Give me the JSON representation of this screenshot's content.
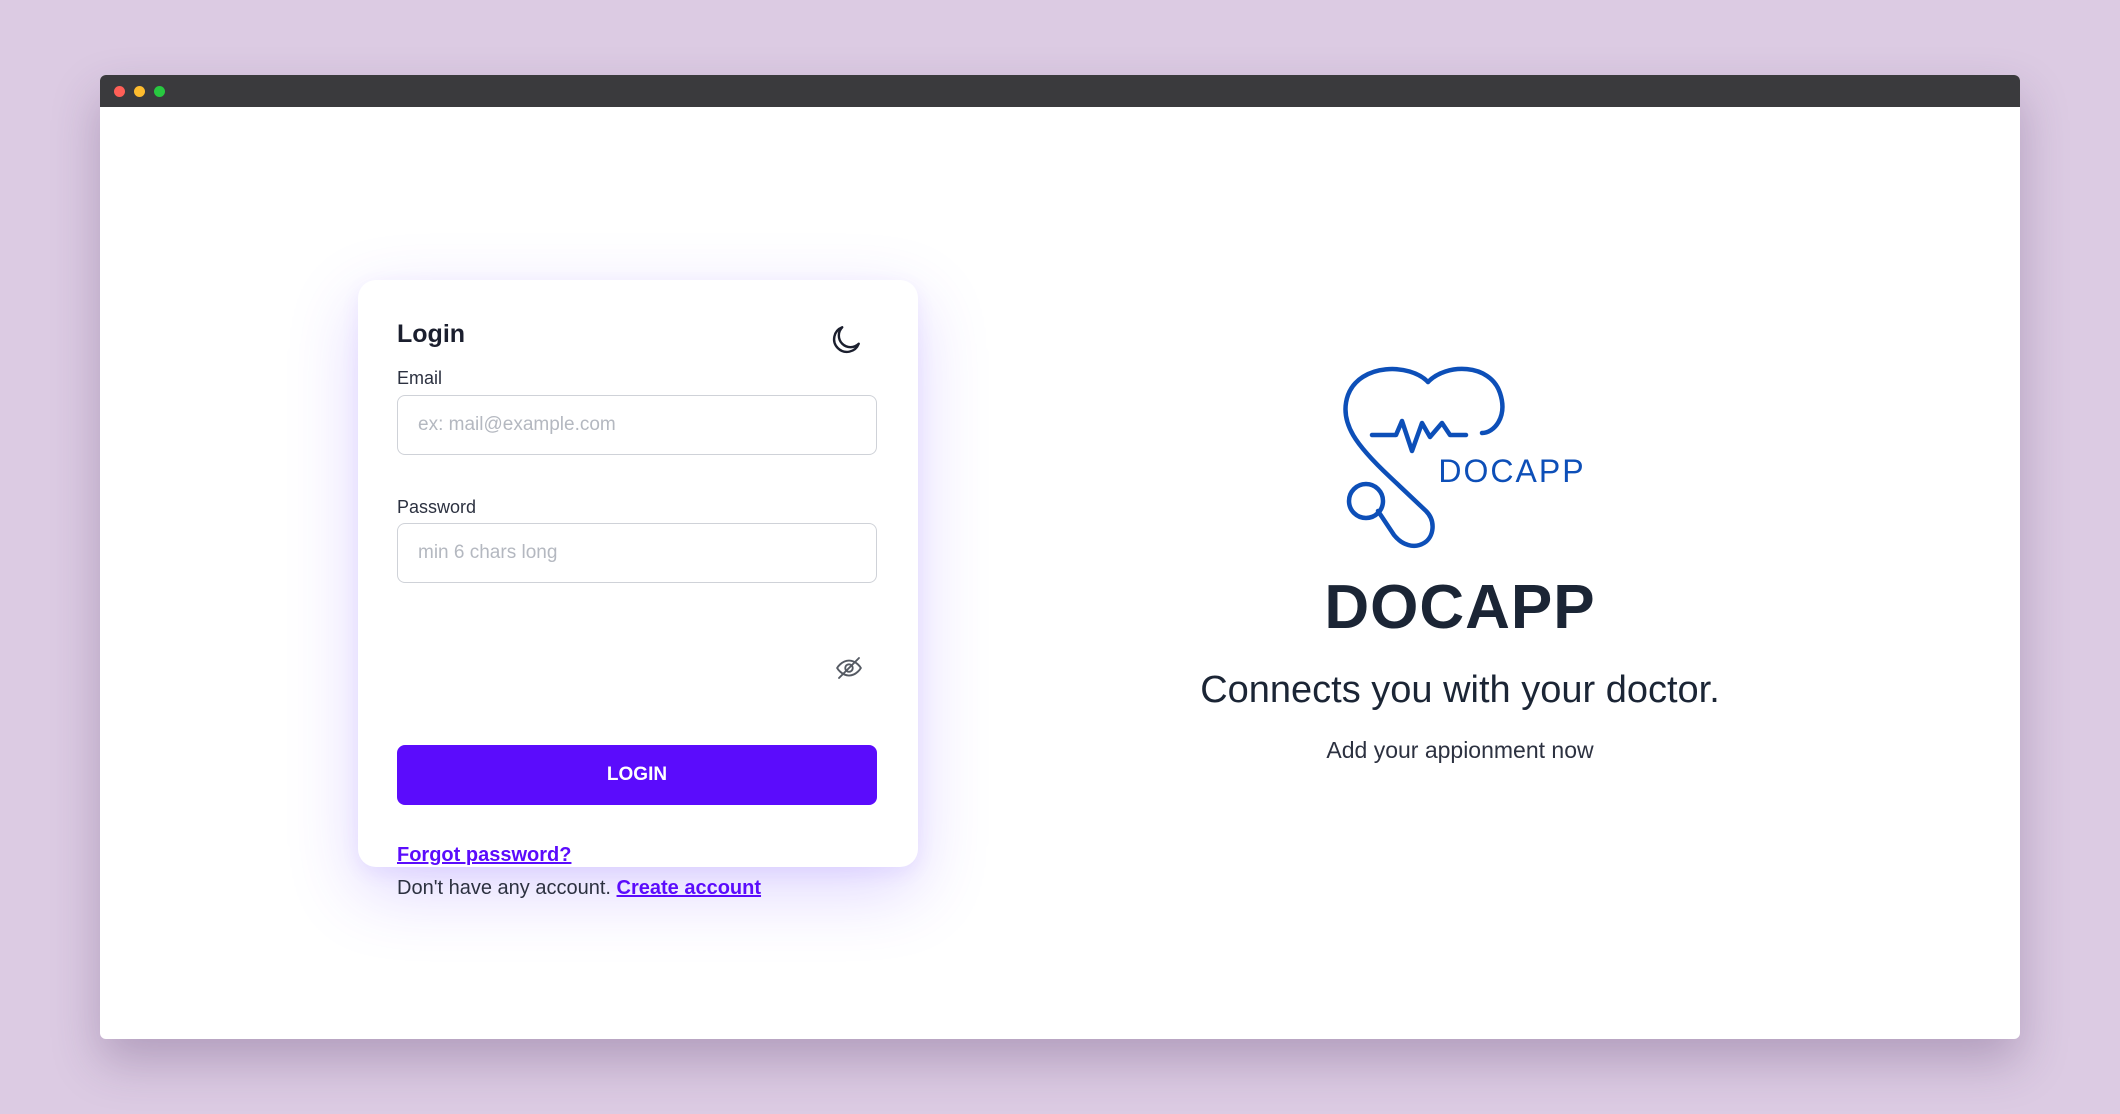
{
  "login": {
    "title": "Login",
    "theme_toggle_icon": "moon-icon",
    "email_label": "Email",
    "email_placeholder": "ex: mail@example.com",
    "email_value": "",
    "password_label": "Password",
    "password_placeholder": "min 6 chars long",
    "password_value": "",
    "password_toggle_icon": "eye-slash-icon",
    "submit_label": "LOGIN",
    "forgot_label": "Forgot password?",
    "no_account_text": "Don't have any account.",
    "create_account_label": "Create account"
  },
  "brand": {
    "logo_text": "DOCAPP",
    "name": "DOCAPP",
    "tagline": "Connects you with your doctor.",
    "subline": "Add your appionment now"
  },
  "colors": {
    "background": "#dccbe3",
    "accent": "#5b0cfc",
    "logo_blue": "#0d4fb8",
    "text_dark": "#1b2535"
  }
}
